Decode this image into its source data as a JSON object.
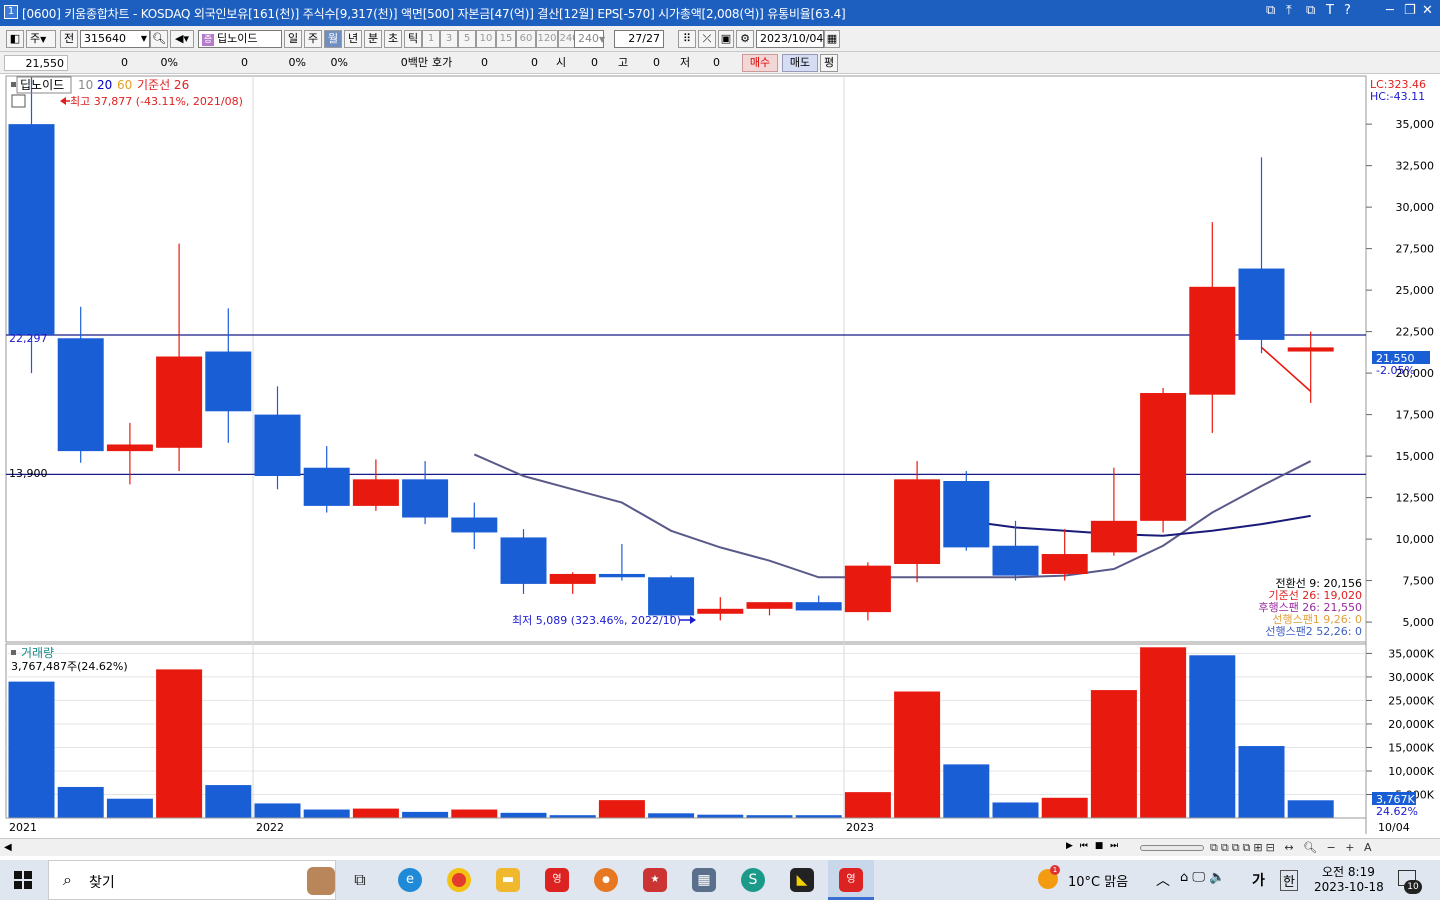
{
  "window": {
    "number": "1",
    "title": "[0600] 키움종합차트 - KOSDAQ 외국인보유[161(천)] 주식수[9,317(천)] 액면[500] 자본금[47(억)] 결산[12월] EPS[-570] 시가총액[2,008(억)] 유통비율[63.4]",
    "controls": [
      "⧉",
      "⤒",
      "⧉",
      "T",
      "?",
      "─",
      "❐",
      "✕"
    ]
  },
  "toolbar": {
    "market_label": "주",
    "all_label": "전",
    "stock_code": "315640",
    "stock_name": "딥노이드",
    "period_buttons": [
      "일",
      "주",
      "월",
      "년",
      "분",
      "초",
      "틱"
    ],
    "selected_period": "월",
    "interval_buttons": [
      "1",
      "3",
      "5",
      "10",
      "15",
      "60",
      "120",
      "240"
    ],
    "interval_input": "240",
    "count": "27/27",
    "date": "2023/10/04"
  },
  "quote": {
    "price": "21,550",
    "change": "0",
    "change_rate": "0%",
    "f1": "0",
    "f1_rate": "0%",
    "f2_rate": "0%",
    "volume_unit": "0백만",
    "hoga_label": "호가",
    "hoga1": "0",
    "hoga2": "0",
    "open_label": "시",
    "open": "0",
    "high_label": "고",
    "high": "0",
    "low_label": "저",
    "low": "0",
    "buy_label": "매수",
    "sell_label": "매도",
    "avg_label": "평"
  },
  "legend": {
    "name": "딥노이드",
    "ma10": "10",
    "ma20": "20",
    "ma60": "60",
    "base_line": "기준선 26",
    "high_note": "최고 37,877 (-43.11%, 2021/08)",
    "low_note": "최저 5,089 (323.46%, 2022/10)",
    "lc": "LC:323.46",
    "hc": "HC:-43.11",
    "hline1_label": "22,297",
    "hline2_label": "13,900",
    "current_price_label": "21,550",
    "current_change_label": "-2.05%"
  },
  "ichimoku": [
    {
      "text": "전환선 9: 20,156",
      "color": "#000000"
    },
    {
      "text": "기준선 26: 19,020",
      "color": "#e02020"
    },
    {
      "text": "후행스팬 26: 21,550",
      "color": "#9a2aa0"
    },
    {
      "text": "선행스팬1 9,26: 0",
      "color": "#e0a040"
    },
    {
      "text": "선행스팬2 52,26: 0",
      "color": "#4060c0"
    }
  ],
  "volume_legend": {
    "title": "거래량",
    "value": "3,767,487주(24.62%)",
    "current_label": "3,767K",
    "current_rate": "24.62%"
  },
  "x_labels": {
    "y2021": "2021",
    "y2022": "2022",
    "y2023": "2023",
    "last": "10/04"
  },
  "colors": {
    "up": "#e8190e",
    "down": "#1a5ed6",
    "title_bar": "#1c5fbf",
    "base_line": "#5a5a8a",
    "long_ma": "#1a1a7a",
    "hline": "#1a1a8a"
  },
  "chart_data": [
    {
      "type": "candlestick",
      "interval": "monthly",
      "y_axis_ticks": [
        5000,
        7500,
        10000,
        12500,
        15000,
        17500,
        20000,
        22500,
        25000,
        27500,
        30000,
        32500,
        35000
      ],
      "y_tick_labels": [
        "5,000",
        "7,500",
        "10,000",
        "12,500",
        "15,000",
        "17,500",
        "20,000",
        "22,500",
        "25,000",
        "27,500",
        "30,000",
        "32,500",
        "35,000"
      ],
      "ylim": [
        3800,
        37900
      ],
      "x_labels": [
        "2021",
        "2022",
        "2023",
        "10/04"
      ],
      "candles": [
        {
          "o": 35000,
          "h": 37877,
          "l": 20000,
          "c": 22300
        },
        {
          "o": 22100,
          "h": 24000,
          "l": 14600,
          "c": 15300
        },
        {
          "o": 15300,
          "h": 17000,
          "l": 13300,
          "c": 15700
        },
        {
          "o": 15500,
          "h": 27800,
          "l": 14100,
          "c": 21000
        },
        {
          "o": 21300,
          "h": 23900,
          "l": 15800,
          "c": 17700
        },
        {
          "o": 17500,
          "h": 19200,
          "l": 13000,
          "c": 13800
        },
        {
          "o": 14300,
          "h": 15600,
          "l": 11600,
          "c": 12000
        },
        {
          "o": 12000,
          "h": 14800,
          "l": 11700,
          "c": 13600
        },
        {
          "o": 13600,
          "h": 14700,
          "l": 10900,
          "c": 11300
        },
        {
          "o": 11300,
          "h": 12200,
          "l": 9400,
          "c": 10400
        },
        {
          "o": 10100,
          "h": 10600,
          "l": 6700,
          "c": 7300
        },
        {
          "o": 7300,
          "h": 8000,
          "l": 6700,
          "c": 7900
        },
        {
          "o": 7900,
          "h": 9700,
          "l": 7500,
          "c": 7700
        },
        {
          "o": 7700,
          "h": 7800,
          "l": 5089,
          "c": 5400
        },
        {
          "o": 5500,
          "h": 6500,
          "l": 5100,
          "c": 5800
        },
        {
          "o": 5800,
          "h": 6200,
          "l": 5400,
          "c": 6200
        },
        {
          "o": 6200,
          "h": 6600,
          "l": 5700,
          "c": 5700
        },
        {
          "o": 5600,
          "h": 8600,
          "l": 5100,
          "c": 8400
        },
        {
          "o": 8500,
          "h": 14700,
          "l": 7400,
          "c": 13600
        },
        {
          "o": 13500,
          "h": 14100,
          "l": 9300,
          "c": 9500
        },
        {
          "o": 9600,
          "h": 11100,
          "l": 7500,
          "c": 7800
        },
        {
          "o": 7900,
          "h": 10600,
          "l": 7500,
          "c": 9100
        },
        {
          "o": 9200,
          "h": 14300,
          "l": 9000,
          "c": 11100
        },
        {
          "o": 11100,
          "h": 19100,
          "l": 10400,
          "c": 18800
        },
        {
          "o": 18700,
          "h": 29100,
          "l": 16400,
          "c": 25200
        },
        {
          "o": 26300,
          "h": 33000,
          "l": 21200,
          "c": 22000
        },
        {
          "o": 21300,
          "h": 22500,
          "l": 18200,
          "c": 21550
        }
      ],
      "base_line_26": [
        null,
        null,
        null,
        null,
        null,
        null,
        null,
        null,
        null,
        15100,
        13800,
        13000,
        12200,
        10500,
        9500,
        8700,
        7700,
        7700,
        7700,
        7700,
        7700,
        7800,
        8200,
        9600,
        11600,
        13200,
        14700
      ],
      "long_ma": [
        null,
        null,
        null,
        null,
        null,
        null,
        null,
        null,
        null,
        null,
        null,
        null,
        null,
        null,
        null,
        null,
        null,
        null,
        null,
        11100,
        10700,
        10500,
        10300,
        10200,
        10500,
        10900,
        11400
      ],
      "lagging_span": [
        null,
        null,
        null,
        null,
        null,
        null,
        null,
        null,
        null,
        null,
        null,
        null,
        null,
        null,
        null,
        null,
        null,
        null,
        null,
        null,
        null,
        null,
        null,
        null,
        null,
        21550,
        18900
      ],
      "hlines": [
        22297,
        13900
      ]
    },
    {
      "type": "bar",
      "title": "거래량",
      "y_axis_ticks": [
        5000,
        10000,
        15000,
        20000,
        25000,
        30000,
        35000
      ],
      "y_tick_labels": [
        "5,000K",
        "10,000K",
        "15,000K",
        "20,000K",
        "25,000K",
        "30,000K",
        "35,000K"
      ],
      "ylim": [
        0,
        37000
      ],
      "unit": "K",
      "values": [
        29000,
        6600,
        4100,
        31600,
        7000,
        3100,
        1800,
        2000,
        1300,
        1800,
        1100,
        600,
        3800,
        1000,
        700,
        600,
        600,
        5500,
        26900,
        11400,
        3300,
        4300,
        27200,
        36300,
        34600,
        15300,
        3767
      ],
      "up": [
        false,
        false,
        false,
        true,
        false,
        false,
        false,
        true,
        false,
        true,
        false,
        false,
        true,
        false,
        false,
        false,
        false,
        true,
        true,
        false,
        false,
        true,
        true,
        true,
        false,
        false,
        false
      ]
    }
  ]
}
